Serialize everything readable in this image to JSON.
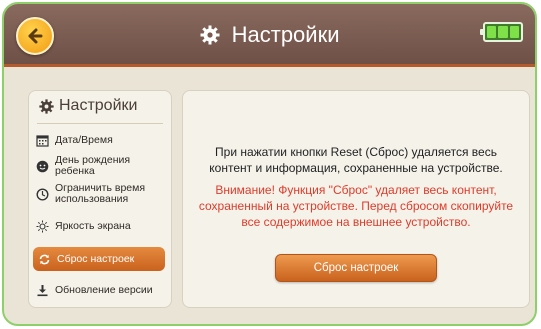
{
  "header": {
    "title": "Настройки",
    "back_icon": "back-arrow-icon",
    "battery_icon": "battery-full-icon",
    "colors": {
      "bar": "#7a5a50",
      "accent": "#c9621d",
      "battery": "#7fe04a"
    }
  },
  "sidebar": {
    "title": "Настройки",
    "items": [
      {
        "label": "Дата/Время",
        "icon": "calendar-icon"
      },
      {
        "label": "День рождения ребенка",
        "icon": "baby-face-icon"
      },
      {
        "label": "Ограничить время использования",
        "icon": "clock-icon"
      },
      {
        "label": "Яркость экрана",
        "icon": "sun-icon"
      },
      {
        "label": "Сброс настроек",
        "icon": "reset-icon",
        "active": true
      },
      {
        "label": "Обновление версии",
        "icon": "download-icon"
      }
    ]
  },
  "content": {
    "info_text": "При нажатии кнопки Reset (Сброс) удаляется весь контент и информация, сохраненные на устройстве.",
    "warning_text": "Внимание! Функция \"Сброс\" удаляет весь контент, сохраненный на устройстве. Перед сбросом скопируйте все содержимое на внешнее устройство.",
    "reset_button_label": "Сброс настроек"
  }
}
